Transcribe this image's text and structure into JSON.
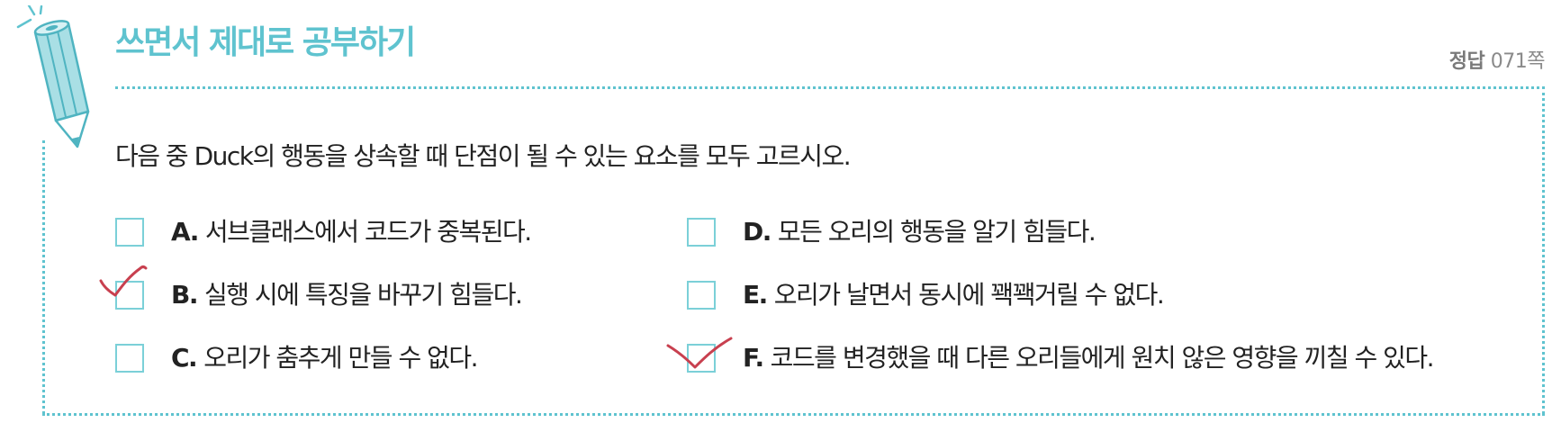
{
  "header": {
    "title": "쓰면서 제대로 공부하기",
    "answer_label": "정답",
    "answer_page": "071쪽",
    "accent_color": "#5fc3cf"
  },
  "question": "다음 중 Duck의 행동을 상속할 때 단점이 될 수 있는 요소를 모두 고르시오.",
  "options": [
    {
      "letter": "A.",
      "text": "서브클래스에서 코드가 중복된다.",
      "checked": false
    },
    {
      "letter": "B.",
      "text": "실행 시에 특징을 바꾸기 힘들다.",
      "checked": true
    },
    {
      "letter": "C.",
      "text": "오리가 춤추게 만들 수 없다.",
      "checked": false
    },
    {
      "letter": "D.",
      "text": "모든 오리의 행동을 알기 힘들다.",
      "checked": false
    },
    {
      "letter": "E.",
      "text": "오리가 날면서 동시에 꽥꽥거릴 수 없다.",
      "checked": false
    },
    {
      "letter": "F.",
      "text": "코드를 변경했을 때 다른 오리들에게 원치 않은 영향을 끼칠 수 있다.",
      "checked": true
    }
  ],
  "colors": {
    "checkbox_border": "#7bd0d8",
    "check_mark": "#c8404f",
    "text": "#222222"
  },
  "icons": {
    "pencil": "pencil-icon",
    "check": "check-mark-icon"
  }
}
